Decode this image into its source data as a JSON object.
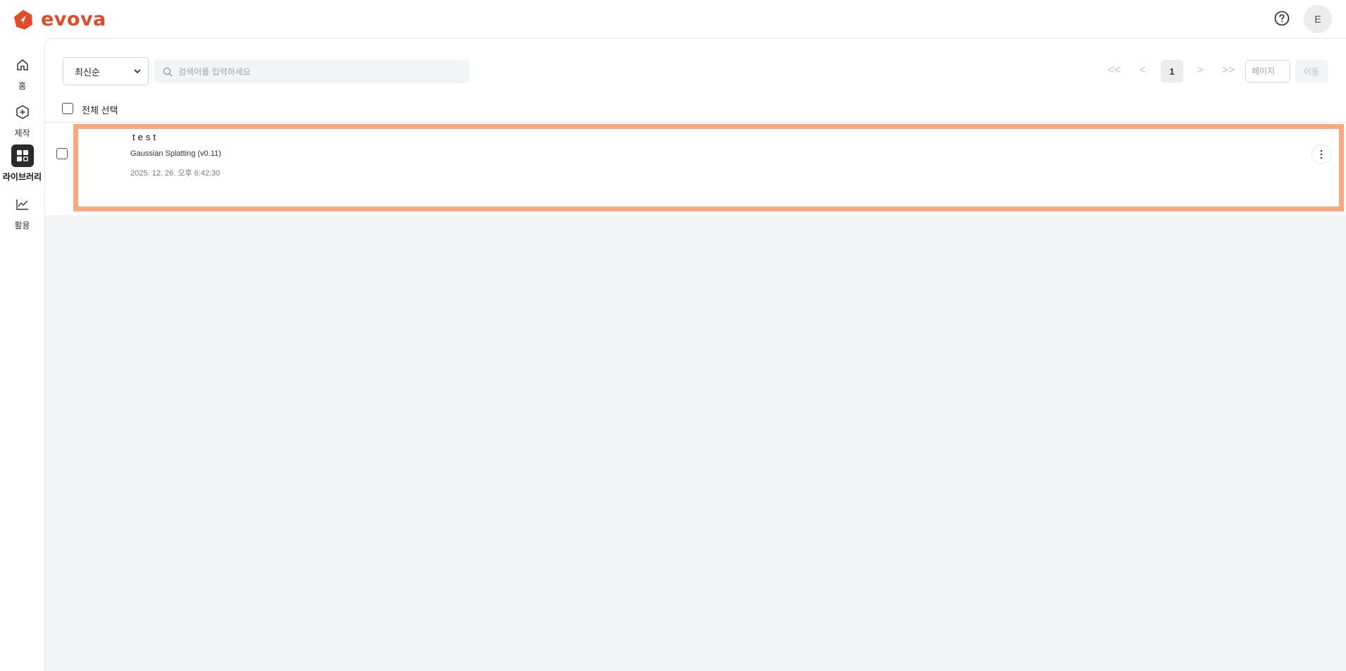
{
  "app": {
    "brand": "evova",
    "brand_color": "#e24b26",
    "user_initial": "E"
  },
  "sidebar": {
    "items": [
      {
        "label": "홈",
        "icon": "home-icon",
        "active": false
      },
      {
        "label": "제작",
        "icon": "hexagon-plus-icon",
        "active": false
      },
      {
        "label": "라이브러리",
        "icon": "library-grid-icon",
        "active": true
      },
      {
        "label": "활용",
        "icon": "chart-line-icon",
        "active": false
      }
    ]
  },
  "toolbar": {
    "sort_value": "최신순",
    "search_placeholder": "검색어를 입력하세요"
  },
  "pagination": {
    "first": "<<",
    "prev": "<",
    "current": "1",
    "next": ">",
    "last": ">>",
    "page_placeholder": "페이지",
    "go_label": "이동"
  },
  "list": {
    "select_all_label": "전체 선택",
    "items": [
      {
        "title": "test",
        "subtitle": "Gaussian Splatting (v0.11)",
        "date": "2025. 12. 26. 오후 6:42:30"
      }
    ]
  },
  "colors": {
    "highlight": "#f9a880",
    "active_nav": "#2b2b2b",
    "panel_bg": "#f3f4f6"
  }
}
